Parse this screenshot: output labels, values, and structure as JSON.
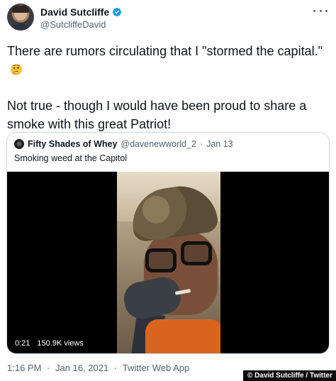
{
  "author": {
    "display_name": "David Sutcliffe",
    "handle": "@SutcliffeDavid"
  },
  "tweet": {
    "paragraph_1": "There are rumors circulating that I \"stormed the capital.\"",
    "paragraph_1_emoji": "thinking-face",
    "paragraph_2": "Not true - though I would have been proud to share a smoke with this great Patriot!"
  },
  "quoted_tweet": {
    "display_name": "Fifty Shades of Whey",
    "handle": "@davenewworld_2",
    "separator": "·",
    "date": "Jan 13",
    "text": "Smoking weed at the Capitol",
    "video": {
      "duration": "0:21",
      "views": "150.9K views"
    }
  },
  "footer": {
    "time": "1:16 PM",
    "separator": "·",
    "date": "Jan 16, 2021",
    "source_separator": "·",
    "source": "Twitter Web App"
  },
  "credit": "© David Sutcliffe / Twitter",
  "colors": {
    "verified_blue": "#1d9bf0",
    "muted_text": "#536471",
    "border": "#cfd9de"
  }
}
